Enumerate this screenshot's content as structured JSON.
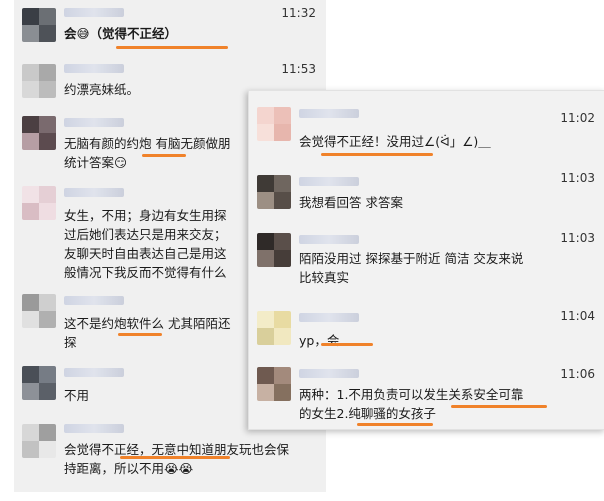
{
  "left_chat": {
    "messages": [
      {
        "time": "11:32",
        "text": "会😅（觉得不正经）"
      },
      {
        "time": "11:53",
        "text": "约漂亮妹纸。"
      },
      {
        "time": "",
        "text": "无脑有颜的约炮 有脑无颜做朋\n统计答案😏"
      },
      {
        "time": "",
        "text": "女生，不用；身边有女生用探\n过后她们表达只是用来交友；\n友聊天时自由表达自己是用这\n般情况下我反而不觉得有什么"
      },
      {
        "time": "",
        "text": "这不是约炮软件么 尤其陌陌还\n探"
      },
      {
        "time": "",
        "text": "不用"
      },
      {
        "time": "",
        "text": "会觉得不正经，无意中知道朋友玩也会保\n持距离，所以不用😭😭"
      }
    ]
  },
  "right_chat": {
    "messages": [
      {
        "time": "11:02",
        "text": "会觉得不正经！没用过∠(ᐛ」∠)＿"
      },
      {
        "time": "11:03",
        "text": "我想看回答 求答案"
      },
      {
        "time": "11:03",
        "text": "陌陌没用过 探探基于附近 简洁 交友来说\n比较真实"
      },
      {
        "time": "11:04",
        "text": "yp，会"
      },
      {
        "time": "11:06",
        "text": "两种：1.不用负责可以发生关系安全可靠\n的女生2.纯聊骚的女孩子"
      }
    ]
  },
  "colors": {
    "underline": "#f0822a",
    "panel": "#f0f0f0"
  }
}
